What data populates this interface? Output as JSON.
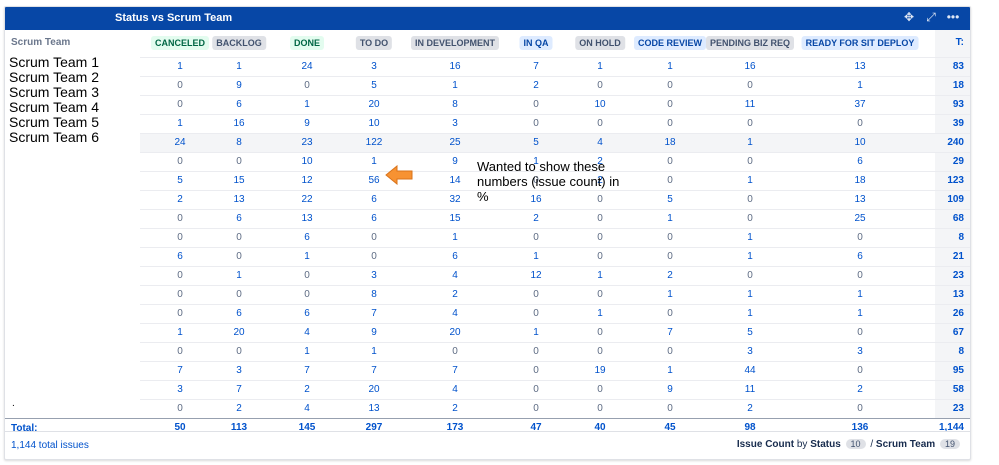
{
  "header": {
    "title": "Status vs Scrum Team"
  },
  "table": {
    "row_label_header": "Scrum Team",
    "total_header": "T:",
    "columns": [
      {
        "label": "CANCELED",
        "style": "green"
      },
      {
        "label": "BACKLOG",
        "style": "grey"
      },
      {
        "label": "DONE",
        "style": "green"
      },
      {
        "label": "TO DO",
        "style": "grey"
      },
      {
        "label": "IN DEVELOPMENT",
        "style": "grey"
      },
      {
        "label": "IN QA",
        "style": "blue"
      },
      {
        "label": "ON HOLD",
        "style": "grey"
      },
      {
        "label": "CODE REVIEW",
        "style": "blue"
      },
      {
        "label": "PENDING BIZ REQ",
        "style": "grey"
      },
      {
        "label": "READY FOR SIT DEPLOY",
        "style": "blue"
      }
    ],
    "rows": [
      {
        "values": [
          "1",
          "1",
          "24",
          "3",
          "16",
          "7",
          "1",
          "1",
          "16",
          "13"
        ],
        "total": "83"
      },
      {
        "values": [
          "0",
          "9",
          "0",
          "5",
          "1",
          "2",
          "0",
          "0",
          "0",
          "1"
        ],
        "total": "18"
      },
      {
        "values": [
          "0",
          "6",
          "1",
          "20",
          "8",
          "0",
          "10",
          "0",
          "11",
          "37"
        ],
        "total": "93"
      },
      {
        "values": [
          "1",
          "16",
          "9",
          "10",
          "3",
          "0",
          "0",
          "0",
          "0",
          "0"
        ],
        "total": "39"
      },
      {
        "values": [
          "24",
          "8",
          "23",
          "122",
          "25",
          "5",
          "4",
          "18",
          "1",
          "10"
        ],
        "total": "240"
      },
      {
        "values": [
          "0",
          "0",
          "10",
          "1",
          "9",
          "1",
          "2",
          "0",
          "0",
          "6"
        ],
        "total": "29"
      },
      {
        "values": [
          "5",
          "15",
          "12",
          "56",
          "14",
          "0",
          "2",
          "0",
          "1",
          "18"
        ],
        "total": "123"
      },
      {
        "values": [
          "2",
          "13",
          "22",
          "6",
          "32",
          "16",
          "0",
          "5",
          "0",
          "13"
        ],
        "total": "109"
      },
      {
        "values": [
          "0",
          "6",
          "13",
          "6",
          "15",
          "2",
          "0",
          "1",
          "0",
          "25"
        ],
        "total": "68"
      },
      {
        "values": [
          "0",
          "0",
          "6",
          "0",
          "1",
          "0",
          "0",
          "0",
          "1",
          "0"
        ],
        "total": "8"
      },
      {
        "values": [
          "6",
          "0",
          "1",
          "0",
          "6",
          "1",
          "0",
          "0",
          "1",
          "6"
        ],
        "total": "21"
      },
      {
        "values": [
          "0",
          "1",
          "0",
          "3",
          "4",
          "12",
          "1",
          "2",
          "0",
          "0"
        ],
        "total": "23"
      },
      {
        "values": [
          "0",
          "0",
          "0",
          "8",
          "2",
          "0",
          "0",
          "1",
          "1",
          "1"
        ],
        "total": "13"
      },
      {
        "values": [
          "0",
          "6",
          "6",
          "7",
          "4",
          "0",
          "1",
          "0",
          "1",
          "1"
        ],
        "total": "26"
      },
      {
        "values": [
          "1",
          "20",
          "4",
          "9",
          "20",
          "1",
          "0",
          "7",
          "5",
          "0"
        ],
        "total": "67"
      },
      {
        "values": [
          "0",
          "0",
          "1",
          "1",
          "0",
          "0",
          "0",
          "0",
          "3",
          "3"
        ],
        "total": "8"
      },
      {
        "values": [
          "7",
          "3",
          "7",
          "7",
          "7",
          "0",
          "19",
          "1",
          "44",
          "0"
        ],
        "total": "95"
      },
      {
        "values": [
          "3",
          "7",
          "2",
          "20",
          "4",
          "0",
          "0",
          "9",
          "11",
          "2"
        ],
        "total": "58"
      },
      {
        "values": [
          "0",
          "2",
          "4",
          "13",
          "2",
          "0",
          "0",
          "0",
          "2",
          "0"
        ],
        "total": "23"
      }
    ],
    "totals": {
      "label": "Total:",
      "values": [
        "50",
        "113",
        "145",
        "297",
        "173",
        "47",
        "40",
        "45",
        "98",
        "136"
      ],
      "grand": "1,144"
    }
  },
  "footer": {
    "total_issues": "1,144 total issues",
    "stat_label": "Issue Count",
    "by": "by",
    "x_field": "Status",
    "x_count": "10",
    "slash": "/",
    "y_field": "Scrum Team",
    "y_count": "19"
  },
  "overlay": {
    "teams": [
      "Scrum Team 1",
      "Scrum Team 2",
      "Scrum Team 3",
      "Scrum Team 4",
      "Scrum Team 5",
      "Scrum Team 6"
    ],
    "annotation": "Wanted to show these numbers (issue count) in %",
    "dot": "."
  },
  "colors": {
    "header": "#0747a6",
    "link": "#0052cc",
    "arrow": "#f79232"
  }
}
